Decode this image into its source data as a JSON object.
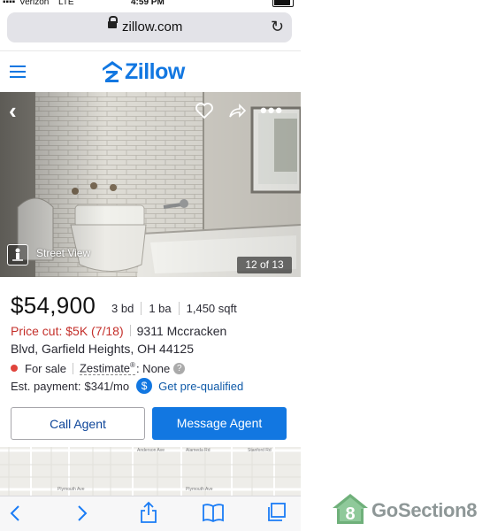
{
  "status_bar": {
    "carrier": "Verizon",
    "network": "LTE",
    "time": "4:59 PM"
  },
  "browser": {
    "url": "zillow.com"
  },
  "brand": {
    "name": "Zillow",
    "color": "#1277e1"
  },
  "photo": {
    "street_view_label": "Street View",
    "counter": "12 of 13"
  },
  "listing": {
    "price": "$54,900",
    "beds": "3 bd",
    "baths": "1 ba",
    "sqft": "1,450 sqft",
    "price_cut": "Price cut: $5K (7/18)",
    "address_line1": "9311 Mccracken",
    "address_line2": "Blvd, Garfield Heights, OH 44125",
    "status": "For sale",
    "zestimate_label": "Zestimate",
    "zestimate_reg": "®",
    "zestimate_value": ": None",
    "est_payment_label": "Est. payment:",
    "est_payment_value": "$341/mo",
    "prequalify_link": "Get pre-qualified"
  },
  "actions": {
    "call_agent": "Call Agent",
    "message_agent": "Message Agent"
  },
  "map": {
    "street_labels": [
      "Plymouth Ave",
      "Plymouth Ave",
      "Anderson Ave",
      "Alameda Rd",
      "Stanford Rd"
    ]
  },
  "colors": {
    "price_cut": "#c4302b",
    "status_dot": "#e0443c",
    "button_primary": "#1277e1",
    "ios_blue": "#1a7cf5"
  },
  "watermark": {
    "text": "GoSection8"
  }
}
